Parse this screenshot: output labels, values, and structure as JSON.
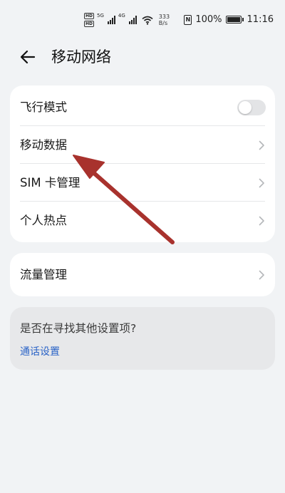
{
  "status_bar": {
    "signal_label_1": "5G",
    "signal_label_2": "4G",
    "net_speed_value": "333",
    "net_speed_unit": "B/s",
    "nfc_label": "N",
    "battery": "100%",
    "time": "11:16",
    "hd_label": "HD"
  },
  "header": {
    "title": "移动网络"
  },
  "settings_group_1": {
    "items": [
      {
        "label": "飞行模式",
        "control": "toggle",
        "on": false
      },
      {
        "label": "移动数据",
        "control": "chevron"
      },
      {
        "label": "SIM 卡管理",
        "control": "chevron"
      },
      {
        "label": "个人热点",
        "control": "chevron"
      }
    ]
  },
  "settings_group_2": {
    "items": [
      {
        "label": "流量管理",
        "control": "chevron"
      }
    ]
  },
  "suggestion": {
    "question": "是否在寻找其他设置项?",
    "link": "通话设置"
  },
  "colors": {
    "background": "#f1f3f5",
    "card": "#ffffff",
    "link": "#2a63c7",
    "annotation_arrow": "#a8322d"
  }
}
